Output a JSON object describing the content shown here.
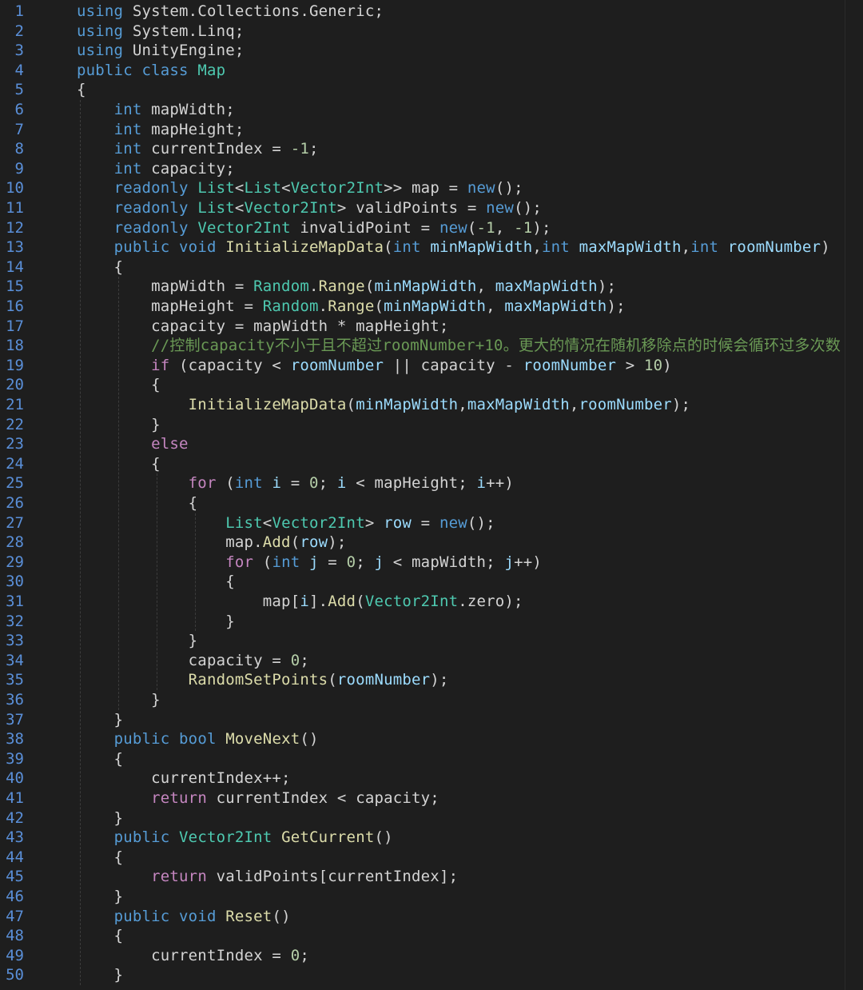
{
  "editor": {
    "line_numbers": [
      "1",
      "2",
      "3",
      "4",
      "5",
      "6",
      "7",
      "8",
      "9",
      "10",
      "11",
      "12",
      "13",
      "14",
      "15",
      "16",
      "17",
      "18",
      "19",
      "20",
      "21",
      "22",
      "23",
      "24",
      "25",
      "26",
      "27",
      "28",
      "29",
      "30",
      "31",
      "32",
      "33",
      "34",
      "35",
      "36",
      "37",
      "38",
      "39",
      "40",
      "41",
      "42",
      "43",
      "44",
      "45",
      "46",
      "47",
      "48",
      "49",
      "50"
    ],
    "lines": [
      [
        [
          "kw",
          "using"
        ],
        [
          "pl",
          " System.Collections.Generic;"
        ]
      ],
      [
        [
          "kw",
          "using"
        ],
        [
          "pl",
          " System.Linq;"
        ]
      ],
      [
        [
          "kw",
          "using"
        ],
        [
          "pl",
          " UnityEngine;"
        ]
      ],
      [
        [
          "kw",
          "public"
        ],
        [
          "pl",
          " "
        ],
        [
          "kw",
          "class"
        ],
        [
          "pl",
          " "
        ],
        [
          "ty",
          "Map"
        ]
      ],
      [
        [
          "pl",
          "{"
        ]
      ],
      [
        [
          "pl",
          "    "
        ],
        [
          "kw",
          "int"
        ],
        [
          "pl",
          " mapWidth;"
        ]
      ],
      [
        [
          "pl",
          "    "
        ],
        [
          "kw",
          "int"
        ],
        [
          "pl",
          " mapHeight;"
        ]
      ],
      [
        [
          "pl",
          "    "
        ],
        [
          "kw",
          "int"
        ],
        [
          "pl",
          " currentIndex = "
        ],
        [
          "nm",
          "-1"
        ],
        [
          "pl",
          ";"
        ]
      ],
      [
        [
          "pl",
          "    "
        ],
        [
          "kw",
          "int"
        ],
        [
          "pl",
          " capacity;"
        ]
      ],
      [
        [
          "pl",
          "    "
        ],
        [
          "kw",
          "readonly"
        ],
        [
          "pl",
          " "
        ],
        [
          "ty",
          "List"
        ],
        [
          "pl",
          "<"
        ],
        [
          "ty",
          "List"
        ],
        [
          "pl",
          "<"
        ],
        [
          "ty",
          "Vector2Int"
        ],
        [
          "pl",
          ">> map = "
        ],
        [
          "kw",
          "new"
        ],
        [
          "pl",
          "();"
        ]
      ],
      [
        [
          "pl",
          "    "
        ],
        [
          "kw",
          "readonly"
        ],
        [
          "pl",
          " "
        ],
        [
          "ty",
          "List"
        ],
        [
          "pl",
          "<"
        ],
        [
          "ty",
          "Vector2Int"
        ],
        [
          "pl",
          "> validPoints = "
        ],
        [
          "kw",
          "new"
        ],
        [
          "pl",
          "();"
        ]
      ],
      [
        [
          "pl",
          "    "
        ],
        [
          "kw",
          "readonly"
        ],
        [
          "pl",
          " "
        ],
        [
          "ty",
          "Vector2Int"
        ],
        [
          "pl",
          " invalidPoint = "
        ],
        [
          "kw",
          "new"
        ],
        [
          "pl",
          "("
        ],
        [
          "nm",
          "-1"
        ],
        [
          "pl",
          ", "
        ],
        [
          "nm",
          "-1"
        ],
        [
          "pl",
          ");"
        ]
      ],
      [
        [
          "pl",
          "    "
        ],
        [
          "kw",
          "public"
        ],
        [
          "pl",
          " "
        ],
        [
          "kw",
          "void"
        ],
        [
          "pl",
          " "
        ],
        [
          "fn",
          "InitializeMapData"
        ],
        [
          "pl",
          "("
        ],
        [
          "kw",
          "int"
        ],
        [
          "pl",
          " "
        ],
        [
          "id",
          "minMapWidth"
        ],
        [
          "pl",
          ","
        ],
        [
          "kw",
          "int"
        ],
        [
          "pl",
          " "
        ],
        [
          "id",
          "maxMapWidth"
        ],
        [
          "pl",
          ","
        ],
        [
          "kw",
          "int"
        ],
        [
          "pl",
          " "
        ],
        [
          "id",
          "roomNumber"
        ],
        [
          "pl",
          ")"
        ]
      ],
      [
        [
          "pl",
          "    {"
        ]
      ],
      [
        [
          "pl",
          "        mapWidth = "
        ],
        [
          "ty",
          "Random"
        ],
        [
          "pl",
          "."
        ],
        [
          "fn",
          "Range"
        ],
        [
          "pl",
          "("
        ],
        [
          "id",
          "minMapWidth"
        ],
        [
          "pl",
          ", "
        ],
        [
          "id",
          "maxMapWidth"
        ],
        [
          "pl",
          ");"
        ]
      ],
      [
        [
          "pl",
          "        mapHeight = "
        ],
        [
          "ty",
          "Random"
        ],
        [
          "pl",
          "."
        ],
        [
          "fn",
          "Range"
        ],
        [
          "pl",
          "("
        ],
        [
          "id",
          "minMapWidth"
        ],
        [
          "pl",
          ", "
        ],
        [
          "id",
          "maxMapWidth"
        ],
        [
          "pl",
          ");"
        ]
      ],
      [
        [
          "pl",
          "        capacity = mapWidth * mapHeight;"
        ]
      ],
      [
        [
          "pl",
          "        "
        ],
        [
          "cm",
          "//控制capacity不小于且不超过roomNumber+10。更大的情况在随机移除点的时候会循环过多次数"
        ]
      ],
      [
        [
          "pl",
          "        "
        ],
        [
          "ctl",
          "if"
        ],
        [
          "pl",
          " (capacity < "
        ],
        [
          "id",
          "roomNumber"
        ],
        [
          "pl",
          " || capacity - "
        ],
        [
          "id",
          "roomNumber"
        ],
        [
          "pl",
          " > "
        ],
        [
          "nm",
          "10"
        ],
        [
          "pl",
          ")"
        ]
      ],
      [
        [
          "pl",
          "        {"
        ]
      ],
      [
        [
          "pl",
          "            "
        ],
        [
          "fn",
          "InitializeMapData"
        ],
        [
          "pl",
          "("
        ],
        [
          "id",
          "minMapWidth"
        ],
        [
          "pl",
          ","
        ],
        [
          "id",
          "maxMapWidth"
        ],
        [
          "pl",
          ","
        ],
        [
          "id",
          "roomNumber"
        ],
        [
          "pl",
          ");"
        ]
      ],
      [
        [
          "pl",
          "        }"
        ]
      ],
      [
        [
          "pl",
          "        "
        ],
        [
          "ctl",
          "else"
        ]
      ],
      [
        [
          "pl",
          "        {"
        ]
      ],
      [
        [
          "pl",
          "            "
        ],
        [
          "ctl",
          "for"
        ],
        [
          "pl",
          " ("
        ],
        [
          "kw",
          "int"
        ],
        [
          "pl",
          " "
        ],
        [
          "id",
          "i"
        ],
        [
          "pl",
          " = "
        ],
        [
          "nm",
          "0"
        ],
        [
          "pl",
          "; "
        ],
        [
          "id",
          "i"
        ],
        [
          "pl",
          " < mapHeight; "
        ],
        [
          "id",
          "i"
        ],
        [
          "pl",
          "++)"
        ]
      ],
      [
        [
          "pl",
          "            {"
        ]
      ],
      [
        [
          "pl",
          "                "
        ],
        [
          "ty",
          "List"
        ],
        [
          "pl",
          "<"
        ],
        [
          "ty",
          "Vector2Int"
        ],
        [
          "pl",
          "> "
        ],
        [
          "id",
          "row"
        ],
        [
          "pl",
          " = "
        ],
        [
          "kw",
          "new"
        ],
        [
          "pl",
          "();"
        ]
      ],
      [
        [
          "pl",
          "                map."
        ],
        [
          "fn",
          "Add"
        ],
        [
          "pl",
          "("
        ],
        [
          "id",
          "row"
        ],
        [
          "pl",
          ");"
        ]
      ],
      [
        [
          "pl",
          "                "
        ],
        [
          "ctl",
          "for"
        ],
        [
          "pl",
          " ("
        ],
        [
          "kw",
          "int"
        ],
        [
          "pl",
          " "
        ],
        [
          "id",
          "j"
        ],
        [
          "pl",
          " = "
        ],
        [
          "nm",
          "0"
        ],
        [
          "pl",
          "; "
        ],
        [
          "id",
          "j"
        ],
        [
          "pl",
          " < mapWidth; "
        ],
        [
          "id",
          "j"
        ],
        [
          "pl",
          "++)"
        ]
      ],
      [
        [
          "pl",
          "                {"
        ]
      ],
      [
        [
          "pl",
          "                    map["
        ],
        [
          "id",
          "i"
        ],
        [
          "pl",
          "]."
        ],
        [
          "fn",
          "Add"
        ],
        [
          "pl",
          "("
        ],
        [
          "ty",
          "Vector2Int"
        ],
        [
          "pl",
          ".zero);"
        ]
      ],
      [
        [
          "pl",
          "                }"
        ]
      ],
      [
        [
          "pl",
          "            }"
        ]
      ],
      [
        [
          "pl",
          "            capacity = "
        ],
        [
          "nm",
          "0"
        ],
        [
          "pl",
          ";"
        ]
      ],
      [
        [
          "pl",
          "            "
        ],
        [
          "fn",
          "RandomSetPoints"
        ],
        [
          "pl",
          "("
        ],
        [
          "id",
          "roomNumber"
        ],
        [
          "pl",
          ");"
        ]
      ],
      [
        [
          "pl",
          "        }"
        ]
      ],
      [
        [
          "pl",
          "    }"
        ]
      ],
      [
        [
          "pl",
          "    "
        ],
        [
          "kw",
          "public"
        ],
        [
          "pl",
          " "
        ],
        [
          "kw",
          "bool"
        ],
        [
          "pl",
          " "
        ],
        [
          "fn",
          "MoveNext"
        ],
        [
          "pl",
          "()"
        ]
      ],
      [
        [
          "pl",
          "    {"
        ]
      ],
      [
        [
          "pl",
          "        currentIndex++;"
        ]
      ],
      [
        [
          "pl",
          "        "
        ],
        [
          "ctl",
          "return"
        ],
        [
          "pl",
          " currentIndex < capacity;"
        ]
      ],
      [
        [
          "pl",
          "    }"
        ]
      ],
      [
        [
          "pl",
          "    "
        ],
        [
          "kw",
          "public"
        ],
        [
          "pl",
          " "
        ],
        [
          "ty",
          "Vector2Int"
        ],
        [
          "pl",
          " "
        ],
        [
          "fn",
          "GetCurrent"
        ],
        [
          "pl",
          "()"
        ]
      ],
      [
        [
          "pl",
          "    {"
        ]
      ],
      [
        [
          "pl",
          "        "
        ],
        [
          "ctl",
          "return"
        ],
        [
          "pl",
          " validPoints[currentIndex];"
        ]
      ],
      [
        [
          "pl",
          "    }"
        ]
      ],
      [
        [
          "pl",
          "    "
        ],
        [
          "kw",
          "public"
        ],
        [
          "pl",
          " "
        ],
        [
          "kw",
          "void"
        ],
        [
          "pl",
          " "
        ],
        [
          "fn",
          "Reset"
        ],
        [
          "pl",
          "()"
        ]
      ],
      [
        [
          "pl",
          "    {"
        ]
      ],
      [
        [
          "pl",
          "        currentIndex = "
        ],
        [
          "nm",
          "0"
        ],
        [
          "pl",
          ";"
        ]
      ],
      [
        [
          "pl",
          "    }"
        ]
      ]
    ]
  },
  "colors": {
    "background": "#1e1e1e",
    "line_number": "#5a8fd8",
    "keyword": "#569cd6",
    "control": "#c586c0",
    "type": "#4ec9b0",
    "function": "#dcdcaa",
    "identifier": "#9cdcfe",
    "plain": "#d4d4d4",
    "number": "#b5cea8",
    "comment": "#6a9955"
  }
}
